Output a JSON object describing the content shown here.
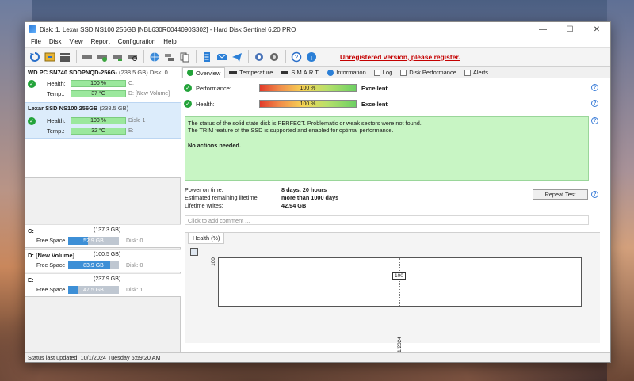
{
  "window": {
    "title": "Disk: 1, Lexar SSD NS100 256GB [NBL630R0044090S302]  -  Hard Disk Sentinel 6.20 PRO",
    "controls": {
      "minimize": "—",
      "maximize": "☐",
      "close": "✕"
    }
  },
  "menu": [
    "File",
    "Disk",
    "View",
    "Report",
    "Configuration",
    "Help"
  ],
  "toolbar": {
    "icons": [
      "refresh-icon",
      "refresh-all-icon",
      "disk-list-icon",
      "drive-icon",
      "drive-test-icon",
      "drive-health-icon",
      "drive-zoom-icon",
      "globe-icon",
      "network-drives-icon",
      "copy-icon",
      "report-icon",
      "email-icon",
      "send-icon",
      "settings-icon",
      "tools-icon",
      "help-icon",
      "info-icon"
    ],
    "unregistered": "Unregistered version, please register."
  },
  "disks": [
    {
      "name": "WD PC SN740 SDDPNQD-256G-",
      "size": "(238.5 GB)",
      "disk_label": "Disk: 0",
      "health_label": "Health:",
      "health": "100 %",
      "health_extra": "C:",
      "temp_label": "Temp.:",
      "temp": "37 °C",
      "temp_extra": "D: [New Volume]"
    },
    {
      "name": "Lexar SSD NS100 256GB",
      "size": "(238.5 GB)",
      "disk_label": "",
      "health_label": "Health:",
      "health": "100 %",
      "health_extra": "Disk: 1",
      "temp_label": "Temp.:",
      "temp": "32 °C",
      "temp_extra": "E:"
    }
  ],
  "volumes": [
    {
      "name": "C:",
      "size": "(137.3 GB)",
      "free_label": "Free Space",
      "free": "52.9 GB",
      "disk": "Disk: 0",
      "free_fraction": 0.39
    },
    {
      "name": "D: [New Volume]",
      "size": "(100.5 GB)",
      "free_label": "Free Space",
      "free": "83.9 GB",
      "disk": "Disk: 0",
      "free_fraction": 0.83
    },
    {
      "name": "E:",
      "size": "(237.9 GB)",
      "free_label": "Free Space",
      "free": "47.5 GB",
      "disk": "Disk: 1",
      "free_fraction": 0.2
    }
  ],
  "tabs": [
    "Overview",
    "Temperature",
    "S.M.A.R.T.",
    "Information",
    "Log",
    "Disk Performance",
    "Alerts"
  ],
  "overview": {
    "performance_label": "Performance:",
    "performance_value": "100 %",
    "performance_text": "Excellent",
    "health_label": "Health:",
    "health_value": "100 %",
    "health_text": "Excellent",
    "status_line1": "The status of the solid state disk is PERFECT. Problematic or weak sectors were not found.",
    "status_line2": "The TRIM feature of the SSD is supported and enabled for optimal performance.",
    "status_line3": "No actions needed.",
    "power_on_label": "Power on time:",
    "power_on_value": "8 days, 20 hours",
    "lifetime_label": "Estimated remaining lifetime:",
    "lifetime_value": "more than 1000 days",
    "writes_label": "Lifetime writes:",
    "writes_value": "42.94 GB",
    "repeat_button": "Repeat Test",
    "comment_placeholder": "Click to add comment ..."
  },
  "graph": {
    "tab": "Health (%)"
  },
  "chart_data": {
    "type": "line",
    "x": [
      "10/1/2024"
    ],
    "series": [
      {
        "values": [
          100
        ]
      }
    ],
    "ylabel_tick": "100",
    "data_label": "100"
  },
  "statusbar": "Status last updated: 10/1/2024 Tuesday 6:59:20 AM",
  "colors": {
    "health_bar": "#9be89d",
    "status_bg": "#c8f5c4",
    "free_bar": "#3d8fd6",
    "warning": "#c40000"
  }
}
